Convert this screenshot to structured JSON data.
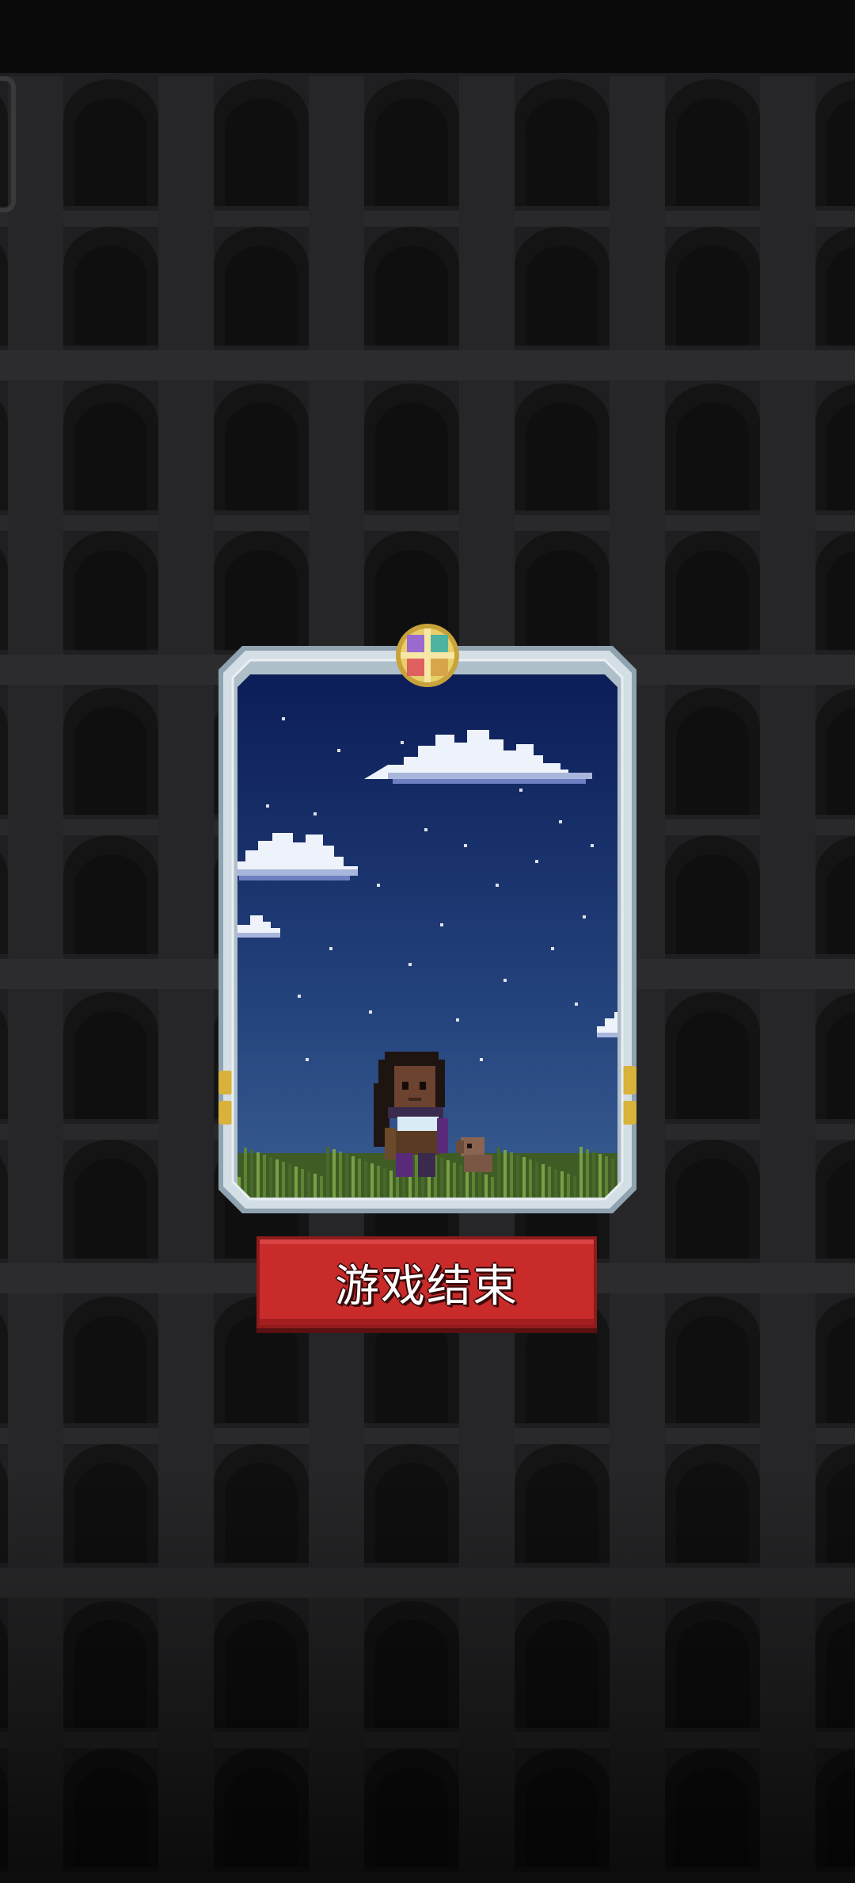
{
  "screen": {
    "name": "game-over-screen"
  },
  "card": {
    "emblem_icon": "quad-color-cross-emblem",
    "scene": "night-sky-with-clouds-girl-and-dog",
    "frame_color": "#c9d6de",
    "sky_top_color": "#0a1a55",
    "sky_bottom_color": "#3a5f94",
    "grass_color": "#4b6a2c"
  },
  "button": {
    "label": "游戏结束",
    "color": "#c92b2b"
  },
  "background": {
    "color": "#1f1f21",
    "pattern": "stone-arch-colonnade"
  }
}
